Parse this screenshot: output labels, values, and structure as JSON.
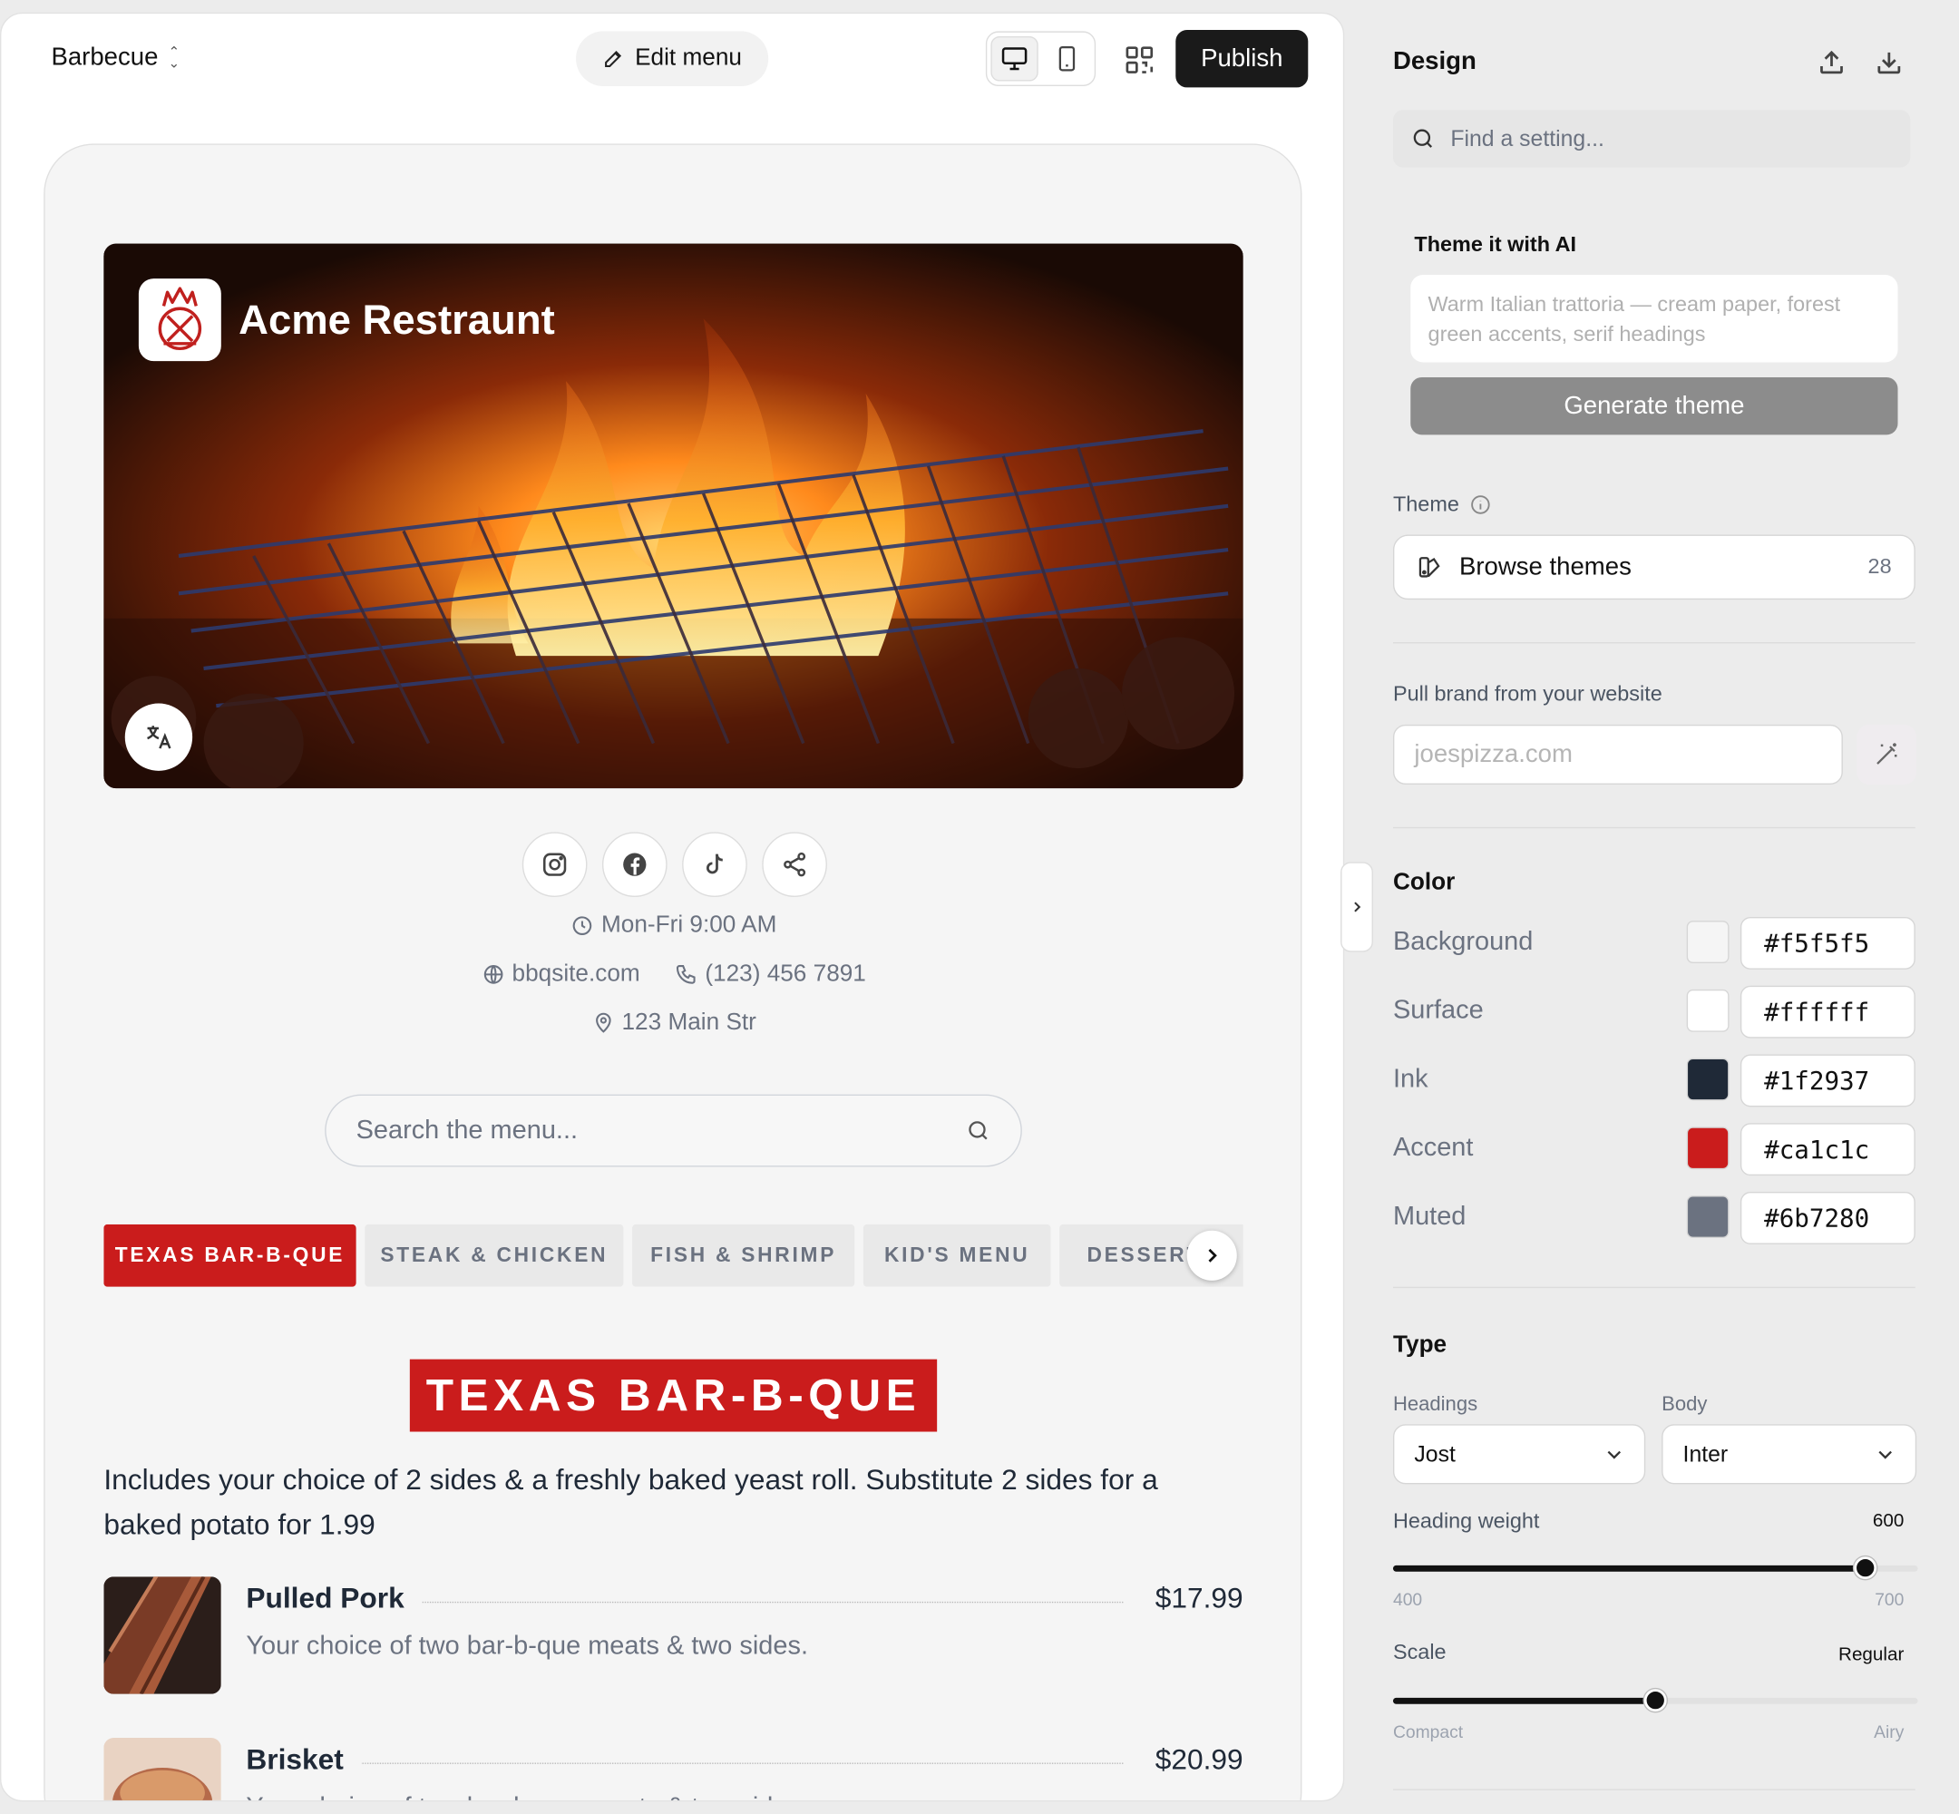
{
  "topbar": {
    "project_name": "Barbecue",
    "edit_menu_label": "Edit menu",
    "publish_label": "Publish"
  },
  "preview": {
    "restaurant_name": "Acme Restraunt",
    "hours": "Mon-Fri 9:00 AM",
    "website": "bbqsite.com",
    "phone": "(123) 456 7891",
    "address": "123 Main Str",
    "search_placeholder": "Search the menu...",
    "tabs": [
      "TEXAS BAR-B-QUE",
      "STEAK & CHICKEN",
      "FISH & SHRIMP",
      "KID'S MENU",
      "DESSERTS"
    ],
    "section_title": "TEXAS BAR-B-QUE",
    "section_description": "Includes your choice of 2 sides & a freshly baked yeast roll. Substitute 2 sides for a baked potato for 1.99",
    "items": [
      {
        "name": "Pulled Pork",
        "price": "$17.99",
        "description": "Your choice of two bar-b-que meats & two sides."
      },
      {
        "name": "Brisket",
        "price": "$20.99",
        "description": "Your choice of two bar-b-que meats & two sides."
      }
    ]
  },
  "panel": {
    "title": "Design",
    "search_placeholder": "Find a setting...",
    "ai": {
      "title": "Theme it with AI",
      "prompt_placeholder": "Warm Italian trattoria — cream paper, forest green accents, serif headings",
      "generate_label": "Generate theme"
    },
    "theme": {
      "label": "Theme",
      "browse_label": "Browse themes",
      "count": "28"
    },
    "brand": {
      "label": "Pull brand from your website",
      "placeholder": "joespizza.com"
    },
    "color": {
      "title": "Color",
      "rows": [
        {
          "label": "Background",
          "hex": "#f5f5f5"
        },
        {
          "label": "Surface",
          "hex": "#ffffff"
        },
        {
          "label": "Ink",
          "hex": "#1f2937"
        },
        {
          "label": "Accent",
          "hex": "#ca1c1c"
        },
        {
          "label": "Muted",
          "hex": "#6b7280"
        }
      ]
    },
    "type": {
      "title": "Type",
      "headings_label": "Headings",
      "headings_font": "Jost",
      "body_label": "Body",
      "body_font": "Inter",
      "weight_label": "Heading weight",
      "weight_value": "600",
      "weight_min": "400",
      "weight_max": "700",
      "weight_fraction": 0.9,
      "scale_label": "Scale",
      "scale_value": "Regular",
      "scale_min": "Compact",
      "scale_max": "Airy",
      "scale_fraction": 0.5
    }
  },
  "icons": {
    "editor": [
      "chevron-up-down-icon",
      "edit-icon",
      "desktop-icon",
      "mobile-icon",
      "qr-code-icon"
    ],
    "preview": [
      "translate-icon",
      "instagram-icon",
      "facebook-icon",
      "tiktok-icon",
      "share-icon",
      "clock-icon",
      "globe-icon",
      "phone-icon",
      "map-pin-icon",
      "search-icon",
      "chevron-right-icon"
    ],
    "panel": [
      "upload-icon",
      "download-icon",
      "search-icon",
      "info-icon",
      "palette-icon",
      "magic-wand-icon",
      "chevron-down-icon"
    ]
  }
}
